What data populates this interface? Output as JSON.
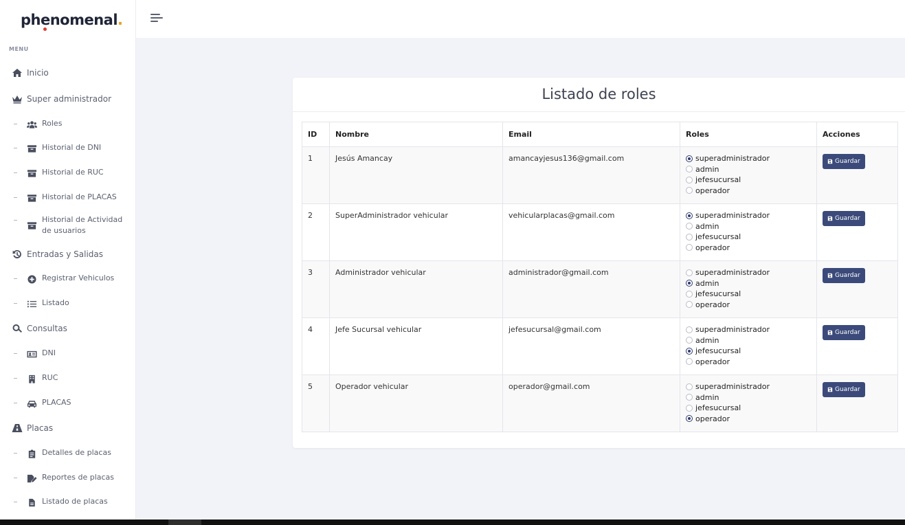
{
  "brand": {
    "name": "phenomenal",
    "dot": "."
  },
  "sidebar": {
    "menu_label": "MENU",
    "items": [
      {
        "label": "Inicio",
        "icon": "home-icon"
      },
      {
        "label": "Super administrador",
        "icon": "crown-icon"
      },
      {
        "label": "Roles",
        "icon": "users-icon",
        "sub": true
      },
      {
        "label": "Historial de DNI",
        "icon": "archive-icon",
        "sub": true
      },
      {
        "label": "Historial de RUC",
        "icon": "archive-icon",
        "sub": true
      },
      {
        "label": "Historial de PLACAS",
        "icon": "archive-icon",
        "sub": true
      },
      {
        "label": "Historial de Actividad",
        "label2": "de usuarios",
        "icon": "archive-icon",
        "sub": true
      },
      {
        "label": "Entradas y Salidas",
        "icon": "history-icon"
      },
      {
        "label": "Registrar Vehiculos",
        "icon": "plus-circle-icon",
        "sub": true
      },
      {
        "label": "Listado",
        "icon": "list-icon",
        "sub": true
      },
      {
        "label": "Consultas",
        "icon": "search-icon"
      },
      {
        "label": "DNI",
        "icon": "id-card-icon",
        "sub": true
      },
      {
        "label": "RUC",
        "icon": "building-icon",
        "sub": true
      },
      {
        "label": "PLACAS",
        "icon": "car-icon",
        "sub": true
      },
      {
        "label": "Placas",
        "icon": "road-icon"
      },
      {
        "label": "Detalles de placas",
        "icon": "clipboard-icon",
        "sub": true
      },
      {
        "label": "Reportes de placas",
        "icon": "file-signature-icon",
        "sub": true
      },
      {
        "label": "Listado de placas",
        "icon": "file-icon",
        "sub": true
      }
    ]
  },
  "main": {
    "title": "Listado de roles",
    "table": {
      "headers": [
        "ID",
        "Nombre",
        "Email",
        "Roles",
        "Acciones"
      ],
      "role_options": [
        "superadministrador",
        "admin",
        "jefesucursal",
        "operador"
      ],
      "button_label": "Guardar",
      "rows": [
        {
          "id": "1",
          "nombre": "Jesús Amancay",
          "email": "amancayjesus136@gmail.com",
          "role": "superadministrador"
        },
        {
          "id": "2",
          "nombre": "SuperAdministrador vehicular",
          "email": "vehicularplacas@gmail.com",
          "role": "superadministrador"
        },
        {
          "id": "3",
          "nombre": "Administrador vehicular",
          "email": "administrador@gmail.com",
          "role": "admin"
        },
        {
          "id": "4",
          "nombre": "Jefe Sucursal vehicular",
          "email": "jefesucursal@gmail.com",
          "role": "jefesucursal"
        },
        {
          "id": "5",
          "nombre": "Operador vehicular",
          "email": "operador@gmail.com",
          "role": "operador"
        }
      ]
    }
  },
  "colors": {
    "accent": "#3b4a7a",
    "logo_dot": "#e8a01d",
    "background": "#f2f3f8"
  }
}
